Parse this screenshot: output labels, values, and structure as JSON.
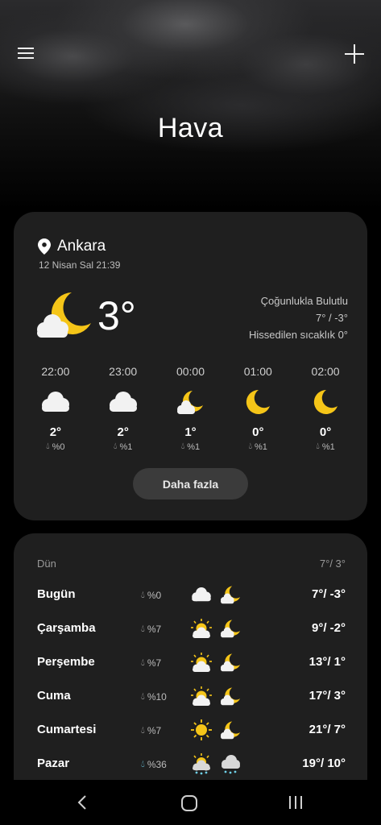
{
  "app": {
    "title": "Hava"
  },
  "current": {
    "location": "Ankara",
    "datetime": "12 Nisan Sal 21:39",
    "temperature": "3°",
    "condition": "Çoğunlukla Bulutlu",
    "high_low": "7° / -3°",
    "feels_like": "Hissedilen sıcaklık 0°",
    "more_label": "Daha fazla"
  },
  "hourly": [
    {
      "time": "22:00",
      "icon": "cloud-icon",
      "temp": "2°",
      "precip": "%0"
    },
    {
      "time": "23:00",
      "icon": "cloud-icon",
      "temp": "2°",
      "precip": "%1"
    },
    {
      "time": "00:00",
      "icon": "moon-cloud-icon",
      "temp": "1°",
      "precip": "%1"
    },
    {
      "time": "01:00",
      "icon": "moon-icon",
      "temp": "0°",
      "precip": "%1"
    },
    {
      "time": "02:00",
      "icon": "moon-icon",
      "temp": "0°",
      "precip": "%1"
    }
  ],
  "yesterday": {
    "label": "Dün",
    "temps": "7°/ 3°"
  },
  "daily": [
    {
      "day": "Bugün",
      "precip": "%0",
      "day_icon": "cloud-icon",
      "night_icon": "moon-cloud-icon",
      "temps": "7°/ -3°"
    },
    {
      "day": "Çarşamba",
      "precip": "%7",
      "day_icon": "sun-cloud-icon",
      "night_icon": "moon-cloud-icon",
      "temps": "9°/ -2°"
    },
    {
      "day": "Perşembe",
      "precip": "%7",
      "day_icon": "sun-cloud-icon",
      "night_icon": "moon-cloud-icon",
      "temps": "13°/ 1°"
    },
    {
      "day": "Cuma",
      "precip": "%10",
      "day_icon": "sun-cloud-icon",
      "night_icon": "moon-cloud-icon",
      "temps": "17°/ 3°"
    },
    {
      "day": "Cumartesi",
      "precip": "%7",
      "day_icon": "sun-icon",
      "night_icon": "moon-cloud-icon",
      "temps": "21°/ 7°"
    },
    {
      "day": "Pazar",
      "precip": "%36",
      "day_icon": "sun-rain-icon",
      "night_icon": "rain-cloud-icon",
      "temps": "19°/ 10°"
    }
  ],
  "colors": {
    "moon": "#f5c518",
    "sun": "#f5c518",
    "cloud": "#f2f2f2",
    "card": "#1f1f1f",
    "rain": "#6fd0e8"
  }
}
